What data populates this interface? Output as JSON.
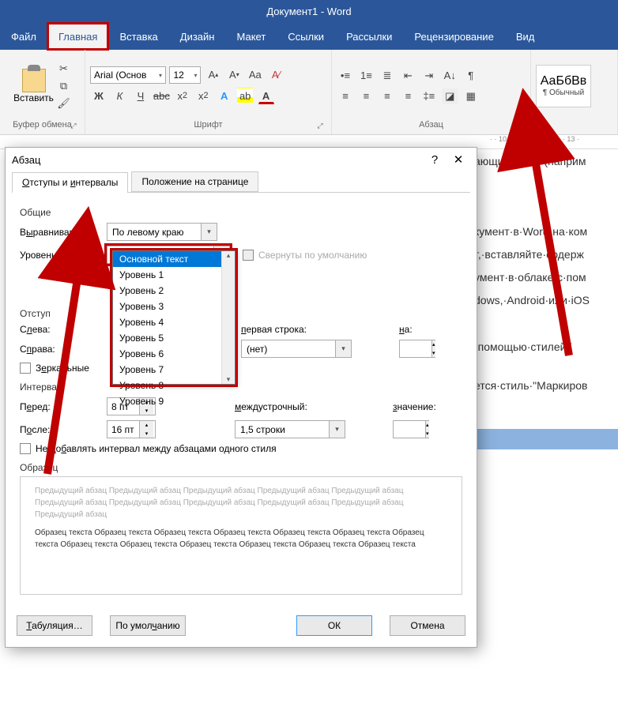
{
  "title": "Документ1 - Word",
  "tabs": [
    "Файл",
    "Главная",
    "Вставка",
    "Дизайн",
    "Макет",
    "Ссылки",
    "Рассылки",
    "Рецензирование",
    "Вид"
  ],
  "active_tab": 1,
  "ribbon": {
    "paste": "Вставить",
    "clipboard_group": "Буфер обмена",
    "font": "Arial (Основ",
    "font_size": "12",
    "font_group": "Шрифт",
    "para_group": "Абзац",
    "style_sample": "АаБбВв",
    "style_name": "¶ Обычный"
  },
  "ruler_text": "· · 10 · · · 11 · · · 12 · · · 13 ·",
  "dialog": {
    "title": "Абзац",
    "tab1": "Отступы и интервалы",
    "tab2": "Положение на странице",
    "section_general": "Общие",
    "align_label": "Выравнивание:",
    "align_value": "По левому краю",
    "level_label": "Уровень:",
    "level_value": "Основной текст",
    "collapsed_label": "Свернуты по умолчанию",
    "section_indent": "Отступ",
    "left_label": "Слева:",
    "right_label": "Справа:",
    "firstline_label": "первая строка:",
    "firstline_value": "(нет)",
    "on_label": "на:",
    "mirror_label": "Зеркальные",
    "section_spacing": "Интервал",
    "before_label": "Перед:",
    "before_value": "8 пт",
    "after_label": "После:",
    "after_value": "16 пт",
    "linespacing_label": "междустрочный:",
    "linespacing_value": "1,5 строки",
    "value_label": "значение:",
    "nospace_label": "Не добавлять интервал между абзацами одного стиля",
    "section_preview": "Образец",
    "preview_prev": "Предыдущий абзац Предыдущий абзац Предыдущий абзац Предыдущий абзац Предыдущий абзац Предыдущий абзац Предыдущий абзац Предыдущий абзац Предыдущий абзац Предыдущий абзац Предыдущий абзац",
    "preview_sample": "Образец текста Образец текста Образец текста Образец текста Образец текста Образец текста Образец текста Образец текста Образец текста Образец текста Образец текста Образец текста Образец текста",
    "btn_tabs": "Табуляция…",
    "btn_default": "По умолчанию",
    "btn_ok": "ОК",
    "btn_cancel": "Отмена",
    "dropdown_options": [
      "Основной текст",
      "Уровень 1",
      "Уровень 2",
      "Уровень 3",
      "Уровень 4",
      "Уровень 5",
      "Уровень 6",
      "Уровень 7",
      "Уровень 8",
      "Уровень 9"
    ]
  },
  "doc_lines": [
    "ающий·текст·(наприм",
    "",
    "кумент·в·Word·на·ком",
    "т,·вставляйте·содерж",
    "умент·в·облаке·с·пом",
    "dows,·Android·или·iOS",
    "·помощью·стилей¶",
    "ется·стиль·\"Маркиров"
  ]
}
